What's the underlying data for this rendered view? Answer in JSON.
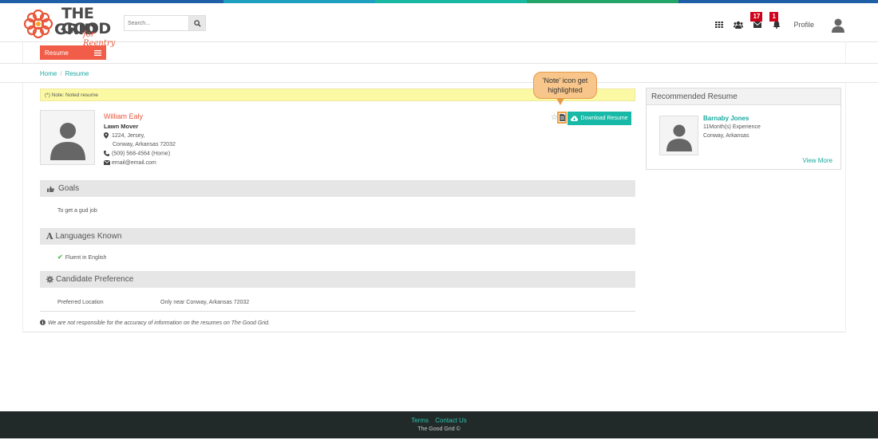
{
  "colors": {
    "accent": "#f15d48",
    "teal": "#18b9a6",
    "note_bg": "#fcf9a4",
    "footer_bg": "#222a29"
  },
  "stripe": [
    "#1f5fa8",
    "#1fa0c0",
    "#1ab8a2",
    "#23a56a",
    "#2a8a3a",
    "#1f5fa8"
  ],
  "logo": {
    "title": "THE GOOD",
    "title2": "GRID",
    "subtitle": "for Reentry"
  },
  "search": {
    "placeholder": "Search..."
  },
  "header": {
    "messages_count": "17",
    "notifications_count": "1",
    "profile_label": "Profile"
  },
  "nav": {
    "resume_label": "Resume"
  },
  "breadcrumb": {
    "home": "Home",
    "separator": "/",
    "current": "Resume"
  },
  "note_bar": {
    "text": "(*) Note: Noted resume"
  },
  "callout": {
    "text": "'Note' icon get highlighted"
  },
  "candidate": {
    "name": "William Ealy",
    "job": "Lawn Mover",
    "address_line1": "1224, Jersey,",
    "address_line2": "Conway, Arkansas  72032",
    "phone": "(509) 568-4564 (Home)",
    "email": "email@email.com"
  },
  "actions": {
    "download_label": "Download Resume"
  },
  "sections": {
    "goals": {
      "title": "Goals",
      "text": "To get a gud job"
    },
    "languages": {
      "title": "Languages Known",
      "item": "Fluent in English"
    },
    "preference": {
      "title": "Candidate Preference",
      "label": "Preferred Location",
      "value": "Only near Conway, Arkansas 72032"
    }
  },
  "disclaimer": "We are not responsible for the accuracy of information on the resumes on The Good Grid.",
  "recommended": {
    "title": "Recommended Resume",
    "name": "Barnaby Jones",
    "experience": "11Month(s) Experience",
    "location": "Conway, Arkansas",
    "view_more": "View More"
  },
  "footer": {
    "terms": "Terms",
    "contact": "Contact Us",
    "copyright": "The Good Grid ©"
  }
}
